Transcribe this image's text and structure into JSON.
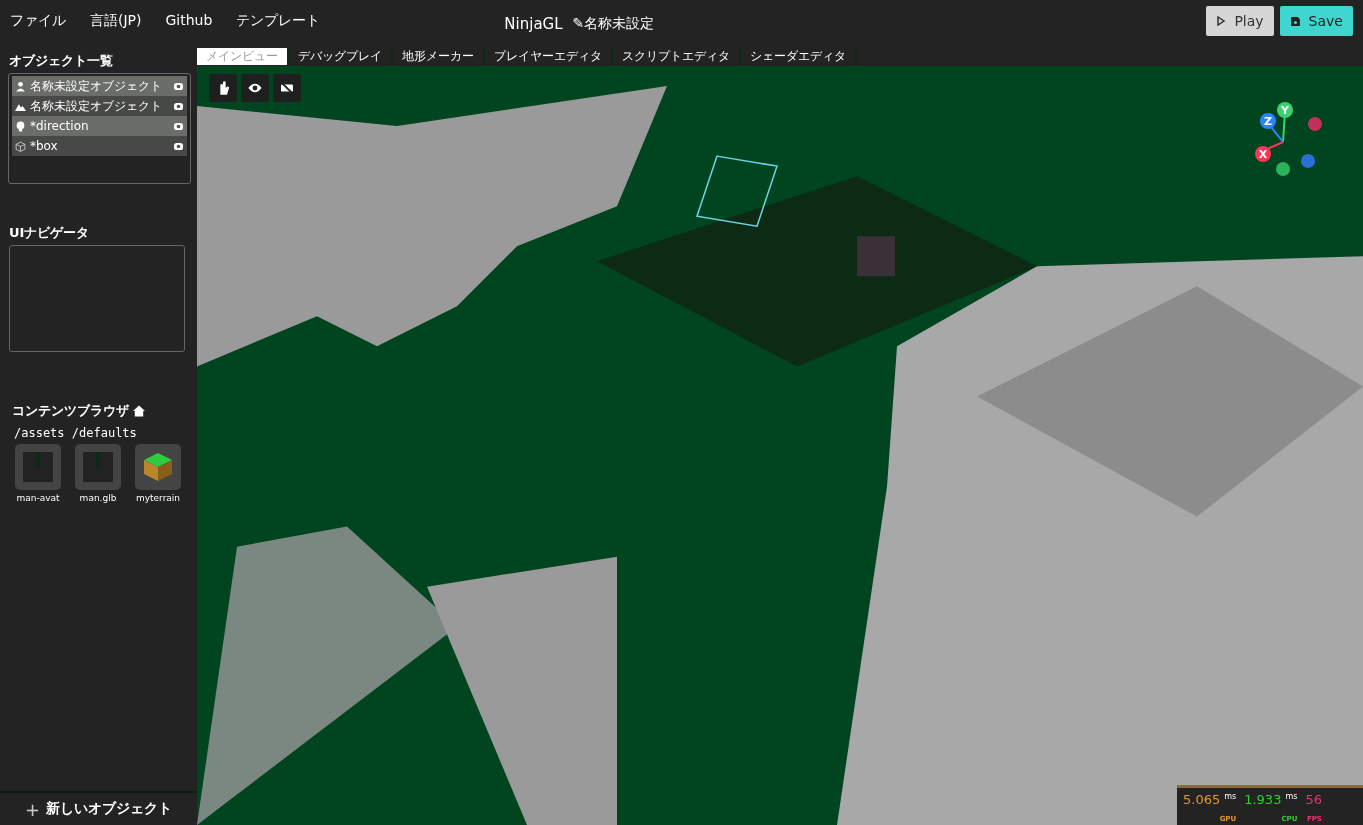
{
  "menu": [
    "ファイル",
    "言語(JP)",
    "Github",
    "テンプレート"
  ],
  "app_title": "NinjaGL",
  "project": {
    "icon": "✎",
    "name": "名称未設定"
  },
  "buttons": [
    {
      "kind": "play",
      "label": "Play"
    },
    {
      "kind": "save",
      "label": "Save"
    }
  ],
  "object_list": {
    "title": "オブジェクト一覧",
    "items": [
      {
        "kind": "avatar",
        "name": "名称未設定オブジェクト",
        "visible": true
      },
      {
        "kind": "terrain",
        "name": "名称未設定オブジェクト",
        "visible": true
      },
      {
        "kind": "light",
        "name": "*direction",
        "visible": true
      },
      {
        "kind": "box",
        "name": "*box",
        "visible": true
      }
    ]
  },
  "ui_navigator": {
    "title": "UIナビゲータ"
  },
  "content_browser": {
    "title": "コンテンツブラウザ",
    "path": "/assets /defaults",
    "files": [
      {
        "kind": "model",
        "name": "man-avat"
      },
      {
        "kind": "model",
        "name": "man.glb"
      },
      {
        "kind": "terrain",
        "name": "myterrain"
      }
    ]
  },
  "new_object": {
    "icon": "+",
    "label": "新しいオブジェクト"
  },
  "tabs": [
    {
      "label": "メインビュー",
      "selected": true
    },
    {
      "label": "デバッグプレイ",
      "selected": false
    },
    {
      "label": "地形メーカー",
      "selected": false
    },
    {
      "label": "プレイヤーエディタ",
      "selected": false
    },
    {
      "label": "スクリプトエディタ",
      "selected": false
    },
    {
      "label": "シェーダエディタ",
      "selected": false
    }
  ],
  "gizmo": {
    "axes": [
      "Y",
      "Z",
      "X"
    ]
  },
  "stats": [
    {
      "value": "5.065",
      "unit": "ms",
      "label": "GPU",
      "color": "#e8952e"
    },
    {
      "value": "1.933",
      "unit": "ms",
      "label": "CPU",
      "color": "#33cc33"
    },
    {
      "value": "56",
      "label": "FPS",
      "color": "#e8336b"
    }
  ]
}
